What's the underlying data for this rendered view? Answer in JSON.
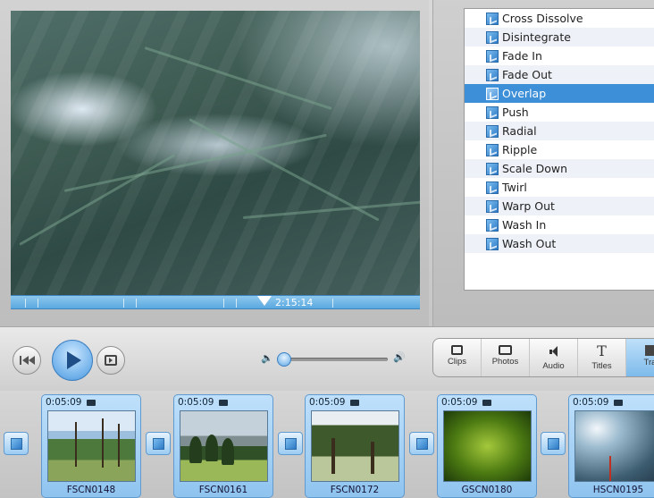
{
  "viewer": {
    "timecode": "2:15:14"
  },
  "transitions": {
    "items": [
      {
        "label": "Cross Dissolve"
      },
      {
        "label": "Disintegrate"
      },
      {
        "label": "Fade In"
      },
      {
        "label": "Fade Out"
      },
      {
        "label": "Overlap",
        "selected": true
      },
      {
        "label": "Push"
      },
      {
        "label": "Radial"
      },
      {
        "label": "Ripple"
      },
      {
        "label": "Scale Down"
      },
      {
        "label": "Twirl"
      },
      {
        "label": "Warp Out"
      },
      {
        "label": "Wash In"
      },
      {
        "label": "Wash Out"
      }
    ],
    "selected_color": "#3d8fd8"
  },
  "controls": {
    "rewind": "rewind-icon",
    "play": "play-icon",
    "fullscreen": "fullscreen-icon",
    "volume_low": "🔈",
    "volume_high": "🔊",
    "volume_level": 0.05
  },
  "tabs": [
    {
      "label": "Clips",
      "icon": "clips-icon"
    },
    {
      "label": "Photos",
      "icon": "photos-icon"
    },
    {
      "label": "Audio",
      "icon": "audio-icon"
    },
    {
      "label": "Titles",
      "icon": "titles-icon",
      "glyph": "T"
    },
    {
      "label": "Tra",
      "icon": "transitions-icon",
      "selected": true
    }
  ],
  "clips": [
    {
      "duration": "0:05:09",
      "name": "FSCN0148"
    },
    {
      "duration": "0:05:09",
      "name": "FSCN0161"
    },
    {
      "duration": "0:05:09",
      "name": "FSCN0172"
    },
    {
      "duration": "0:05:09",
      "name": "GSCN0180"
    },
    {
      "duration": "0:05:09",
      "name": "HSCN0195"
    }
  ],
  "colors": {
    "accent": "#3d8fd8",
    "clip_bg": "#bfe0fb"
  }
}
